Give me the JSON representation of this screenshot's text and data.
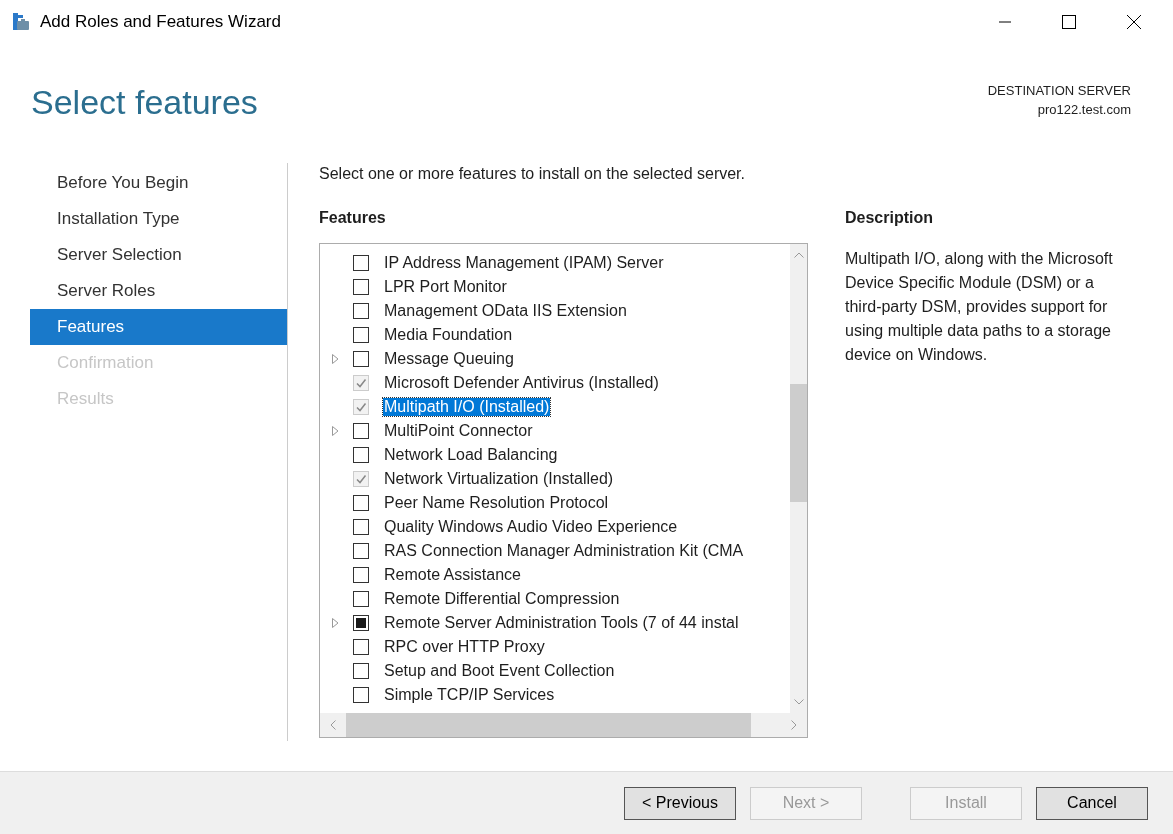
{
  "window": {
    "title": "Add Roles and Features Wizard"
  },
  "page_title": "Select features",
  "destination": {
    "label": "DESTINATION SERVER",
    "server": "pro122.test.com"
  },
  "nav": [
    {
      "label": "Before You Begin",
      "selected": false,
      "disabled": false
    },
    {
      "label": "Installation Type",
      "selected": false,
      "disabled": false
    },
    {
      "label": "Server Selection",
      "selected": false,
      "disabled": false
    },
    {
      "label": "Server Roles",
      "selected": false,
      "disabled": false
    },
    {
      "label": "Features",
      "selected": true,
      "disabled": false
    },
    {
      "label": "Confirmation",
      "selected": false,
      "disabled": true
    },
    {
      "label": "Results",
      "selected": false,
      "disabled": true
    }
  ],
  "instruction": "Select one or more features to install on the selected server.",
  "features_heading": "Features",
  "features": [
    {
      "label": "IP Address Management (IPAM) Server",
      "checked": false,
      "indeterminate": false,
      "disabled": false,
      "expandable": false,
      "selected": false
    },
    {
      "label": "LPR Port Monitor",
      "checked": false,
      "indeterminate": false,
      "disabled": false,
      "expandable": false,
      "selected": false
    },
    {
      "label": "Management OData IIS Extension",
      "checked": false,
      "indeterminate": false,
      "disabled": false,
      "expandable": false,
      "selected": false
    },
    {
      "label": "Media Foundation",
      "checked": false,
      "indeterminate": false,
      "disabled": false,
      "expandable": false,
      "selected": false
    },
    {
      "label": "Message Queuing",
      "checked": false,
      "indeterminate": false,
      "disabled": false,
      "expandable": true,
      "selected": false
    },
    {
      "label": "Microsoft Defender Antivirus (Installed)",
      "checked": true,
      "indeterminate": false,
      "disabled": true,
      "expandable": false,
      "selected": false
    },
    {
      "label": "Multipath I/O (Installed)",
      "checked": true,
      "indeterminate": false,
      "disabled": true,
      "expandable": false,
      "selected": true
    },
    {
      "label": "MultiPoint Connector",
      "checked": false,
      "indeterminate": false,
      "disabled": false,
      "expandable": true,
      "selected": false
    },
    {
      "label": "Network Load Balancing",
      "checked": false,
      "indeterminate": false,
      "disabled": false,
      "expandable": false,
      "selected": false
    },
    {
      "label": "Network Virtualization (Installed)",
      "checked": true,
      "indeterminate": false,
      "disabled": true,
      "expandable": false,
      "selected": false
    },
    {
      "label": "Peer Name Resolution Protocol",
      "checked": false,
      "indeterminate": false,
      "disabled": false,
      "expandable": false,
      "selected": false
    },
    {
      "label": "Quality Windows Audio Video Experience",
      "checked": false,
      "indeterminate": false,
      "disabled": false,
      "expandable": false,
      "selected": false
    },
    {
      "label": "RAS Connection Manager Administration Kit (CMA",
      "checked": false,
      "indeterminate": false,
      "disabled": false,
      "expandable": false,
      "selected": false
    },
    {
      "label": "Remote Assistance",
      "checked": false,
      "indeterminate": false,
      "disabled": false,
      "expandable": false,
      "selected": false
    },
    {
      "label": "Remote Differential Compression",
      "checked": false,
      "indeterminate": false,
      "disabled": false,
      "expandable": false,
      "selected": false
    },
    {
      "label": "Remote Server Administration Tools (7 of 44 instal",
      "checked": false,
      "indeterminate": true,
      "disabled": false,
      "expandable": true,
      "selected": false
    },
    {
      "label": "RPC over HTTP Proxy",
      "checked": false,
      "indeterminate": false,
      "disabled": false,
      "expandable": false,
      "selected": false
    },
    {
      "label": "Setup and Boot Event Collection",
      "checked": false,
      "indeterminate": false,
      "disabled": false,
      "expandable": false,
      "selected": false
    },
    {
      "label": "Simple TCP/IP Services",
      "checked": false,
      "indeterminate": false,
      "disabled": false,
      "expandable": false,
      "selected": false
    }
  ],
  "description_heading": "Description",
  "description": "Multipath I/O, along with the Microsoft Device Specific Module (DSM) or a third-party DSM, provides support for using multiple data paths to a storage device on Windows.",
  "buttons": [
    {
      "label": "< Previous",
      "disabled": false
    },
    {
      "label": "Next >",
      "disabled": true
    },
    {
      "label": "Install",
      "disabled": true
    },
    {
      "label": "Cancel",
      "disabled": false
    }
  ]
}
